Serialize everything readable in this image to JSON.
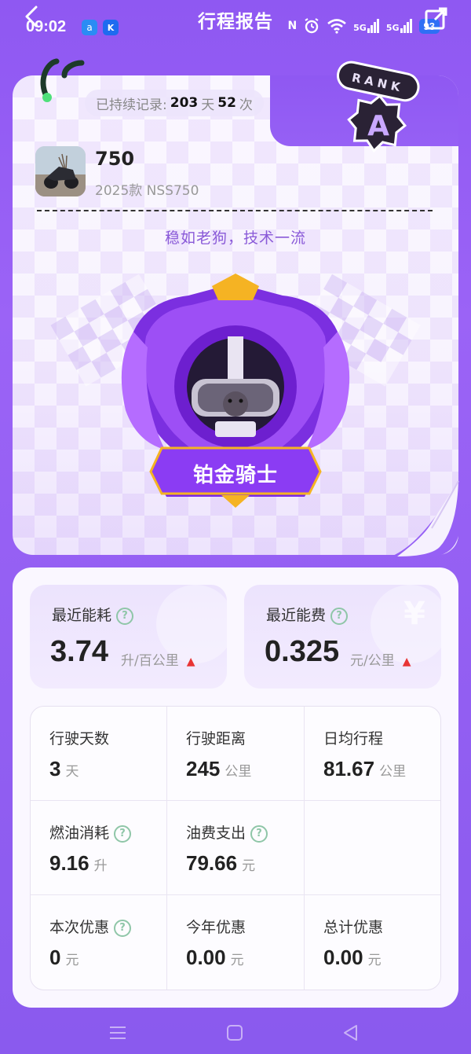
{
  "status_bar": {
    "time": "09:02",
    "app_icon_1": "a",
    "app_icon_2": "K",
    "nfc": "N",
    "network_1": "5G",
    "network_2": "5G",
    "battery": "93"
  },
  "header": {
    "title": "行程报告"
  },
  "streak": {
    "prefix": "已持续记录:",
    "days": "203",
    "days_unit": "天",
    "count": "52",
    "count_unit": "次"
  },
  "rank": {
    "word": "RANK",
    "grade": "A"
  },
  "vehicle": {
    "name": "750",
    "model": "2025款 NSS750"
  },
  "slogan": "稳如老狗，技术一流",
  "medal": {
    "title": "铂金骑士"
  },
  "metrics": {
    "consumption": {
      "label": "最近能耗",
      "value": "3.74",
      "unit": "升/百公里",
      "trend": "up"
    },
    "cost": {
      "label": "最近能费",
      "value": "0.325",
      "unit": "元/公里",
      "trend": "up"
    }
  },
  "stats": {
    "driving_days": {
      "label": "行驶天数",
      "value": "3",
      "unit": "天"
    },
    "distance": {
      "label": "行驶距离",
      "value": "245",
      "unit": "公里"
    },
    "daily_avg": {
      "label": "日均行程",
      "value": "81.67",
      "unit": "公里"
    },
    "fuel_used": {
      "label": "燃油消耗",
      "value": "9.16",
      "unit": "升"
    },
    "fuel_cost": {
      "label": "油费支出",
      "value": "79.66",
      "unit": "元"
    },
    "discount_this": {
      "label": "本次优惠",
      "value": "0",
      "unit": "元"
    },
    "discount_year": {
      "label": "今年优惠",
      "value": "0.00",
      "unit": "元"
    },
    "discount_total": {
      "label": "总计优惠",
      "value": "0.00",
      "unit": "元"
    }
  },
  "colors": {
    "background": "#8f58f2",
    "accent_purple": "#8a5ad8",
    "trend_up": "#e83535",
    "help_icon": "#8fc6a8"
  },
  "icons": {
    "back": "back-arrow-icon",
    "share": "share-icon",
    "help": "question-circle-icon",
    "up": "up-arrow-icon"
  }
}
